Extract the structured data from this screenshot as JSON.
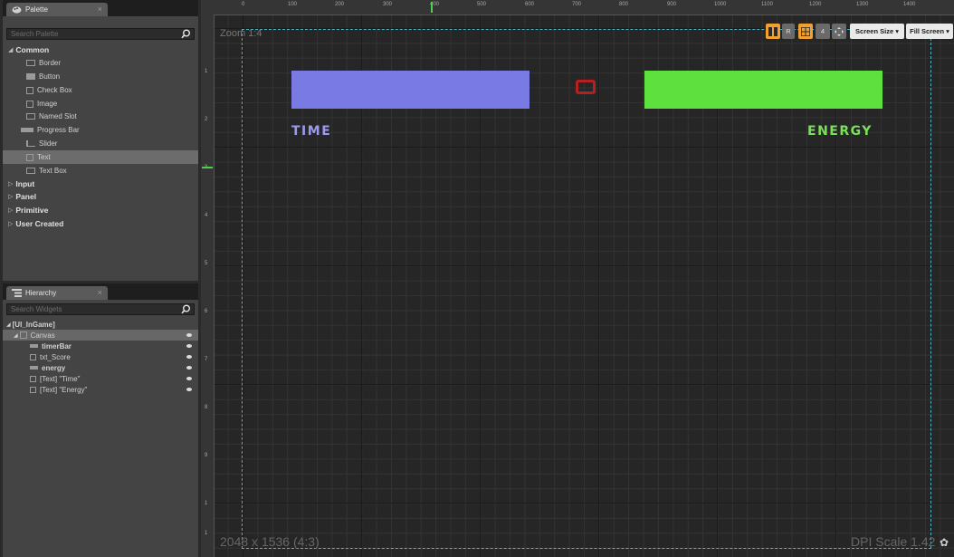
{
  "palette": {
    "tab_title": "Palette",
    "search_placeholder": "Search Palette",
    "categories": [
      {
        "label": "Common",
        "expanded": true
      },
      {
        "label": "Input",
        "expanded": false
      },
      {
        "label": "Panel",
        "expanded": false
      },
      {
        "label": "Primitive",
        "expanded": false
      },
      {
        "label": "User Created",
        "expanded": false
      }
    ],
    "items": [
      {
        "label": "Border",
        "icon": "border-icon"
      },
      {
        "label": "Button",
        "icon": "button-icon"
      },
      {
        "label": "Check Box",
        "icon": "checkbox-icon"
      },
      {
        "label": "Image",
        "icon": "image-icon"
      },
      {
        "label": "Named Slot",
        "icon": "named-slot-icon"
      },
      {
        "label": "Progress Bar",
        "icon": "progress-bar-icon"
      },
      {
        "label": "Slider",
        "icon": "slider-icon"
      },
      {
        "label": "Text",
        "icon": "text-icon",
        "selected": true
      },
      {
        "label": "Text Box",
        "icon": "textbox-icon"
      }
    ]
  },
  "hierarchy": {
    "tab_title": "Hierarchy",
    "search_placeholder": "Search Widgets",
    "rows": [
      {
        "label": "[UI_InGame]",
        "bold": true
      },
      {
        "label": "Canvas"
      },
      {
        "label": "timerBar",
        "bold": true
      },
      {
        "label": "txt_Score"
      },
      {
        "label": "energy",
        "bold": true
      },
      {
        "label": "[Text] \"Time\""
      },
      {
        "label": "[Text] \"Energy\""
      }
    ]
  },
  "designer": {
    "zoom_label": "Zoom 1:4",
    "resolution_label": "2048 x 1536 (4:3)",
    "dpi_label": "DPI Scale 1.42",
    "ruler_ticks": [
      "0",
      "100",
      "200",
      "300",
      "400",
      "500",
      "600",
      "700",
      "800",
      "900",
      "1000",
      "1100",
      "1200",
      "1300",
      "1400"
    ],
    "vertical_ticks": [
      "1",
      "2",
      "3",
      "4",
      "5",
      "6",
      "7",
      "8",
      "9",
      "1",
      "1"
    ],
    "time_label": "TIME",
    "energy_label": "ENERGY",
    "toolbar": {
      "r_button": "R",
      "snap_value": "4",
      "screen_size": "Screen Size ▾",
      "fill_screen": "Fill Screen ▾"
    },
    "colors": {
      "time_bar": "#7a7ae4",
      "energy_bar": "#5ee03e",
      "score_box": "#b62020",
      "safe_frame": "#4fb3c8"
    }
  }
}
